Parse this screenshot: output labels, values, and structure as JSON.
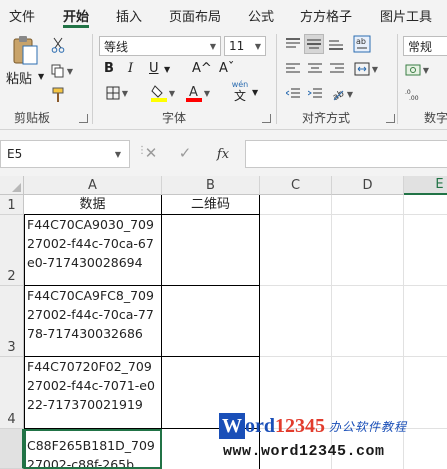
{
  "tabs": [
    "文件",
    "开始",
    "插入",
    "页面布局",
    "公式",
    "方方格子",
    "图片工具"
  ],
  "active_tab": "开始",
  "ribbon": {
    "clipboard": {
      "paste_label": "粘贴",
      "group_label": "剪贴板"
    },
    "font": {
      "font_name": "等线",
      "font_size": "11",
      "bold": "B",
      "italic": "I",
      "underline": "U",
      "grow": "A^",
      "shrink": "Aˇ",
      "phonetic_top": "wén",
      "phonetic_char": "文",
      "group_label": "字体",
      "fill_color": "#ffff00",
      "font_color": "#ff0000"
    },
    "alignment": {
      "group_label": "对齐方式"
    },
    "number": {
      "format": "常规",
      "group_label": "数字"
    }
  },
  "formula_bar": {
    "cell_ref": "E5",
    "fx": "fx",
    "content": ""
  },
  "grid": {
    "columns": [
      "A",
      "B",
      "C",
      "D",
      "E"
    ],
    "rows": [
      "1",
      "2",
      "3",
      "4",
      ""
    ],
    "selected_col": "E",
    "header_row": {
      "a": "数据",
      "b": "二维码"
    },
    "data": [
      "F44C70CA9030_70927002-f44c-70ca-67e0-717430028694",
      "F44C70CA9FC8_70927002-f44c-70ca-7778-717430032686",
      "F44C70720F02_70927002-f44c-7071-e022-717370021919",
      "C88F265B181D_70927002-c88f-265b"
    ]
  },
  "watermark": {
    "w": "W",
    "ord": "ord",
    "num": "12345",
    "cn": "办公软件教程",
    "url": "www.word12345.com"
  }
}
